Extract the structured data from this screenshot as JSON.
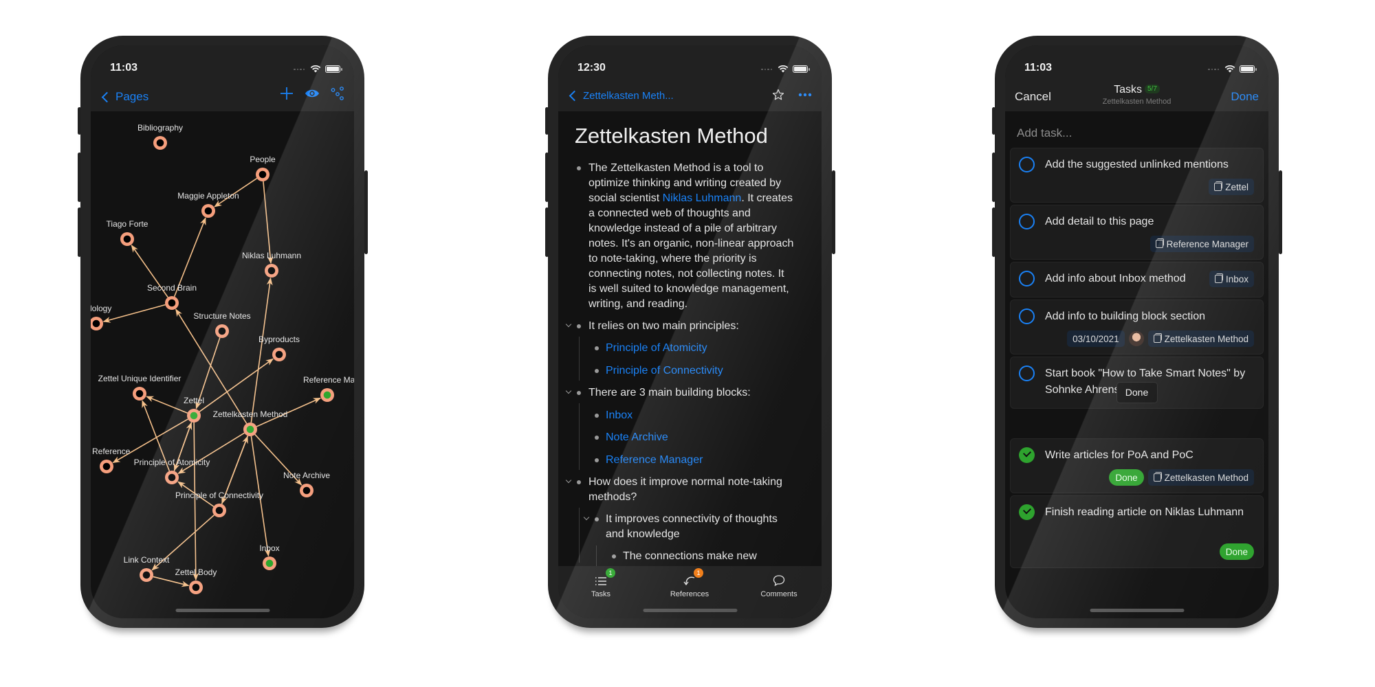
{
  "phones": [
    {
      "status": {
        "time": "11:03"
      },
      "nav": {
        "back_label": "Pages",
        "actions": [
          "plus-icon",
          "eye-icon",
          "graph-icon"
        ]
      },
      "graph": {
        "link_color": "#f5c08a",
        "node_ring_color": "#f59e7c",
        "node_active_color": "#2aa52a",
        "nodes": [
          {
            "id": "bibliography",
            "label": "Bibliography",
            "active": false
          },
          {
            "id": "people",
            "label": "People",
            "active": false
          },
          {
            "id": "maggie",
            "label": "Maggie Appleton",
            "active": false
          },
          {
            "id": "tiago",
            "label": "Tiago Forte",
            "active": false
          },
          {
            "id": "niklas",
            "label": "Niklas Luhmann",
            "active": false
          },
          {
            "id": "secondbrain",
            "label": "Second Brain",
            "active": false
          },
          {
            "id": "methodology",
            "label": "Methodology",
            "active": false
          },
          {
            "id": "structure",
            "label": "Structure Notes",
            "active": false
          },
          {
            "id": "byproducts",
            "label": "Byproducts",
            "active": false
          },
          {
            "id": "zuid",
            "label": "Zettel Unique Identifier",
            "active": false
          },
          {
            "id": "refmgr",
            "label": "Reference Manager",
            "active": true
          },
          {
            "id": "zettel",
            "label": "Zettel",
            "active": true
          },
          {
            "id": "zkm",
            "label": "Zettelkasten Method",
            "active": true
          },
          {
            "id": "zref",
            "label": "Zettel Reference",
            "active": false
          },
          {
            "id": "poa",
            "label": "Principle of Atomicity",
            "active": false
          },
          {
            "id": "notearchive",
            "label": "Note Archive",
            "active": false
          },
          {
            "id": "poc",
            "label": "Principle of Connectivity",
            "active": false
          },
          {
            "id": "inbox",
            "label": "Inbox",
            "active": true
          },
          {
            "id": "linkctx",
            "label": "Link Context",
            "active": false
          },
          {
            "id": "zbody",
            "label": "Zettel Body",
            "active": false
          }
        ],
        "edges": [
          [
            "people",
            "maggie"
          ],
          [
            "people",
            "niklas"
          ],
          [
            "secondbrain",
            "maggie"
          ],
          [
            "secondbrain",
            "tiago"
          ],
          [
            "secondbrain",
            "methodology"
          ],
          [
            "zkm",
            "secondbrain"
          ],
          [
            "zkm",
            "niklas"
          ],
          [
            "structure",
            "zettel"
          ],
          [
            "zettel",
            "byproducts"
          ],
          [
            "zettel",
            "zuid"
          ],
          [
            "zettel",
            "zref"
          ],
          [
            "zettel",
            "poa"
          ],
          [
            "zettel",
            "zbody"
          ],
          [
            "poa",
            "zettel"
          ],
          [
            "poa",
            "zuid"
          ],
          [
            "zkm",
            "refmgr"
          ],
          [
            "zkm",
            "poa"
          ],
          [
            "zkm",
            "poc"
          ],
          [
            "poc",
            "zkm"
          ],
          [
            "zkm",
            "notearchive"
          ],
          [
            "zkm",
            "inbox"
          ],
          [
            "poc",
            "poa"
          ],
          [
            "poc",
            "linkctx"
          ],
          [
            "linkctx",
            "zbody"
          ]
        ]
      }
    },
    {
      "status": {
        "time": "12:30"
      },
      "nav": {
        "back_label": "Zettelkasten Meth...",
        "actions": [
          "star-icon",
          "more-icon"
        ]
      },
      "doc": {
        "title": "Zettelkasten Method",
        "intro_lines": [
          "The Zettelkasten Method is a tool to",
          "optimize thinking and writing created by",
          [
            "social scientist ",
            "Niklas Luhmann",
            ". It creates"
          ],
          "a connected web of thoughts and",
          "knowledge instead of a pile of arbitrary",
          "notes. It's an organic, non-linear approach",
          "to note-taking, where the priority is",
          "connecting notes, not collecting notes. It",
          "is well suited to knowledge management,",
          "writing, and reading."
        ],
        "intro_link": "Niklas Luhmann",
        "principles_heading": "It relies on two main principles:",
        "principles": [
          "Principle of Atomicity",
          "Principle of Connectivity"
        ],
        "blocks_heading": "There are 3 main building blocks:",
        "blocks": [
          "Inbox",
          "Note Archive",
          "Reference Manager"
        ],
        "improve_heading_l1": "How does it improve normal note-taking",
        "improve_heading_l2": "methods?",
        "improve_sub_l1": "It improves connectivity of thoughts",
        "improve_sub_l2": "and knowledge",
        "improve_sub_child": "The connections make new"
      },
      "tabbar": [
        {
          "label": "Tasks",
          "icon": "list-icon",
          "badge": "1",
          "badge_color": "#2aa52a"
        },
        {
          "label": "References",
          "icon": "backlink-icon",
          "badge": "1",
          "badge_color": "#f07c16"
        },
        {
          "label": "Comments",
          "icon": "comment-icon",
          "badge": null
        }
      ]
    },
    {
      "status": {
        "time": "11:03"
      },
      "nav": {
        "cancel_label": "Cancel",
        "title": "Tasks",
        "count": "5/7",
        "subtitle": "Zettelkasten Method",
        "done_label": "Done"
      },
      "add_task_placeholder": "Add task...",
      "open_tasks": [
        {
          "text": "Add the suggested unlinked mentions",
          "chips": [
            {
              "type": "page",
              "label": "Zettel"
            }
          ]
        },
        {
          "text": "Add detail to this page",
          "chips": [
            {
              "type": "page",
              "label": "Reference Manager"
            }
          ]
        },
        {
          "text": "Add info about Inbox method",
          "chips": [
            {
              "type": "page",
              "label": "Inbox"
            }
          ]
        },
        {
          "text": "Add info to building block section",
          "chips": [
            {
              "type": "date",
              "label": "03/10/2021"
            },
            {
              "type": "avatar",
              "label": ""
            },
            {
              "type": "page",
              "label": "Zettelkasten Method"
            }
          ]
        },
        {
          "text": "Start book \"How to Take Smart Notes\" by Sohnke Ahrens",
          "chips": []
        }
      ],
      "done_section_label": "Done",
      "done_tasks": [
        {
          "text": "Write articles for PoA and PoC",
          "chips": [
            {
              "type": "done",
              "label": "Done"
            },
            {
              "type": "page",
              "label": "Zettelkasten Method"
            }
          ]
        },
        {
          "text": "Finish reading article on Niklas Luhmann",
          "chips": [
            {
              "type": "done",
              "label": "Done"
            }
          ]
        }
      ]
    }
  ]
}
